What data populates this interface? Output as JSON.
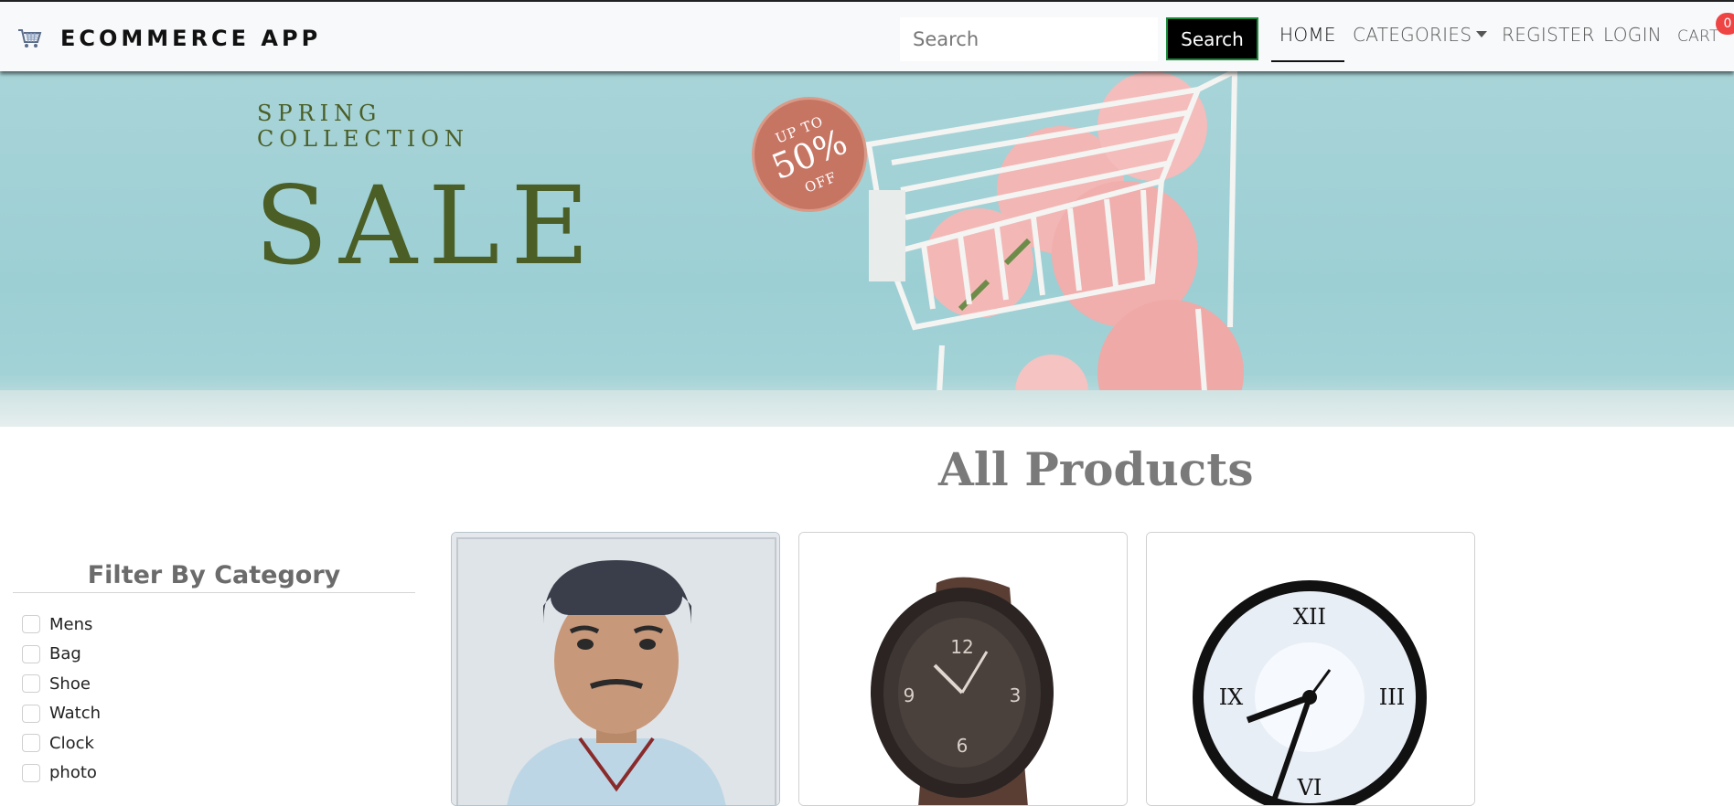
{
  "navbar": {
    "brand": "ECOMMERCE APP",
    "brand_icon": "cart-icon",
    "search_placeholder": "Search",
    "search_button": "Search",
    "links": {
      "home": "HOME",
      "categories": "CATEGORIES",
      "register": "REGISTER",
      "login": "LOGIN",
      "cart": "CART"
    },
    "cart_count": "0",
    "colors": {
      "search_button_bg": "#000000",
      "cart_badge": "#ef4444"
    }
  },
  "banner": {
    "line1": "SPRING",
    "line2": "COLLECTION",
    "headline": "SALE",
    "badge_top": "UP TO",
    "badge_percent": "50%",
    "badge_bottom": "OFF",
    "colors": {
      "background": "#a8d4d8",
      "text": "#4a5e26",
      "badge": "#c77563"
    }
  },
  "main": {
    "heading": "All Products"
  },
  "sidebar": {
    "title": "Filter By Category",
    "categories": [
      "Mens",
      "Bag",
      "Shoe",
      "Watch",
      "Clock",
      "photo"
    ]
  },
  "products": [
    {
      "image": "person-portrait-photo"
    },
    {
      "image": "wristwatch-photo"
    },
    {
      "image": "wall-clock-photo"
    }
  ]
}
